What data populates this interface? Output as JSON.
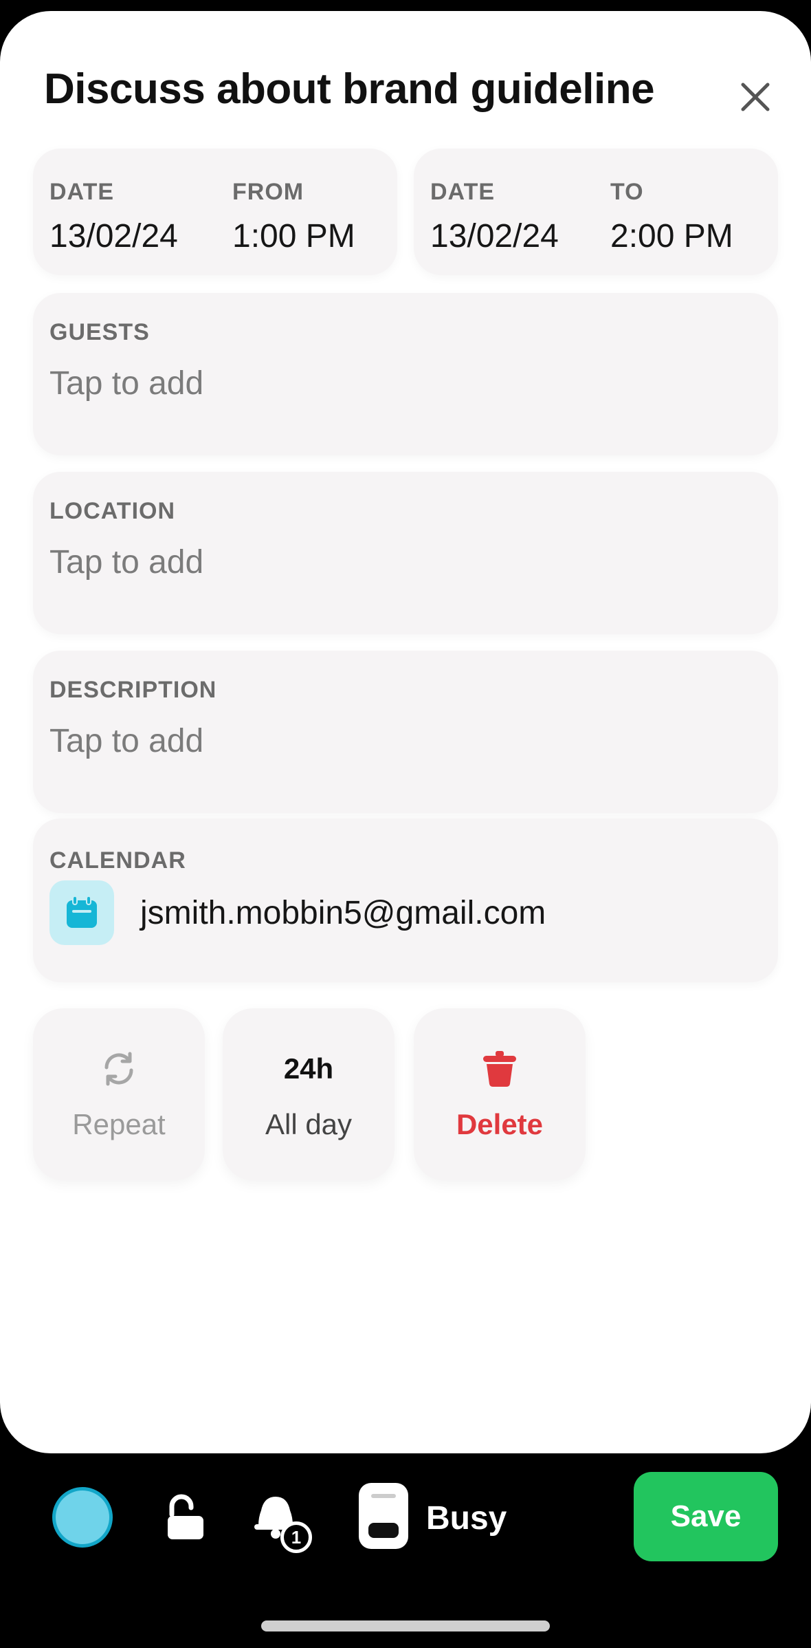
{
  "event": {
    "title": "Discuss about brand guideline"
  },
  "start": {
    "date_label": "DATE",
    "date_value": "13/02/24",
    "time_label": "FROM",
    "time_value": "1:00 PM"
  },
  "end": {
    "date_label": "DATE",
    "date_value": "13/02/24",
    "time_label": "TO",
    "time_value": "2:00 PM"
  },
  "guests": {
    "label": "GUESTS",
    "placeholder": "Tap to add"
  },
  "location": {
    "label": "LOCATION",
    "placeholder": "Tap to add"
  },
  "description": {
    "label": "DESCRIPTION",
    "placeholder": "Tap to add"
  },
  "calendar": {
    "label": "CALENDAR",
    "account": "jsmith.mobbin5@gmail.com",
    "icon": "calendar-icon",
    "icon_color": "#16b6d6"
  },
  "actions": {
    "repeat_label": "Repeat",
    "repeat_icon": "repeat-icon",
    "allday_badge": "24h",
    "allday_label": "All day",
    "delete_label": "Delete",
    "delete_icon": "trash-icon",
    "delete_color": "#e0393e"
  },
  "toolbar": {
    "color_swatch": "#6fd3ea",
    "lock_icon": "unlock-icon",
    "notification_count": "1",
    "status_label": "Busy",
    "save_label": "Save",
    "save_color": "#22c55e"
  }
}
